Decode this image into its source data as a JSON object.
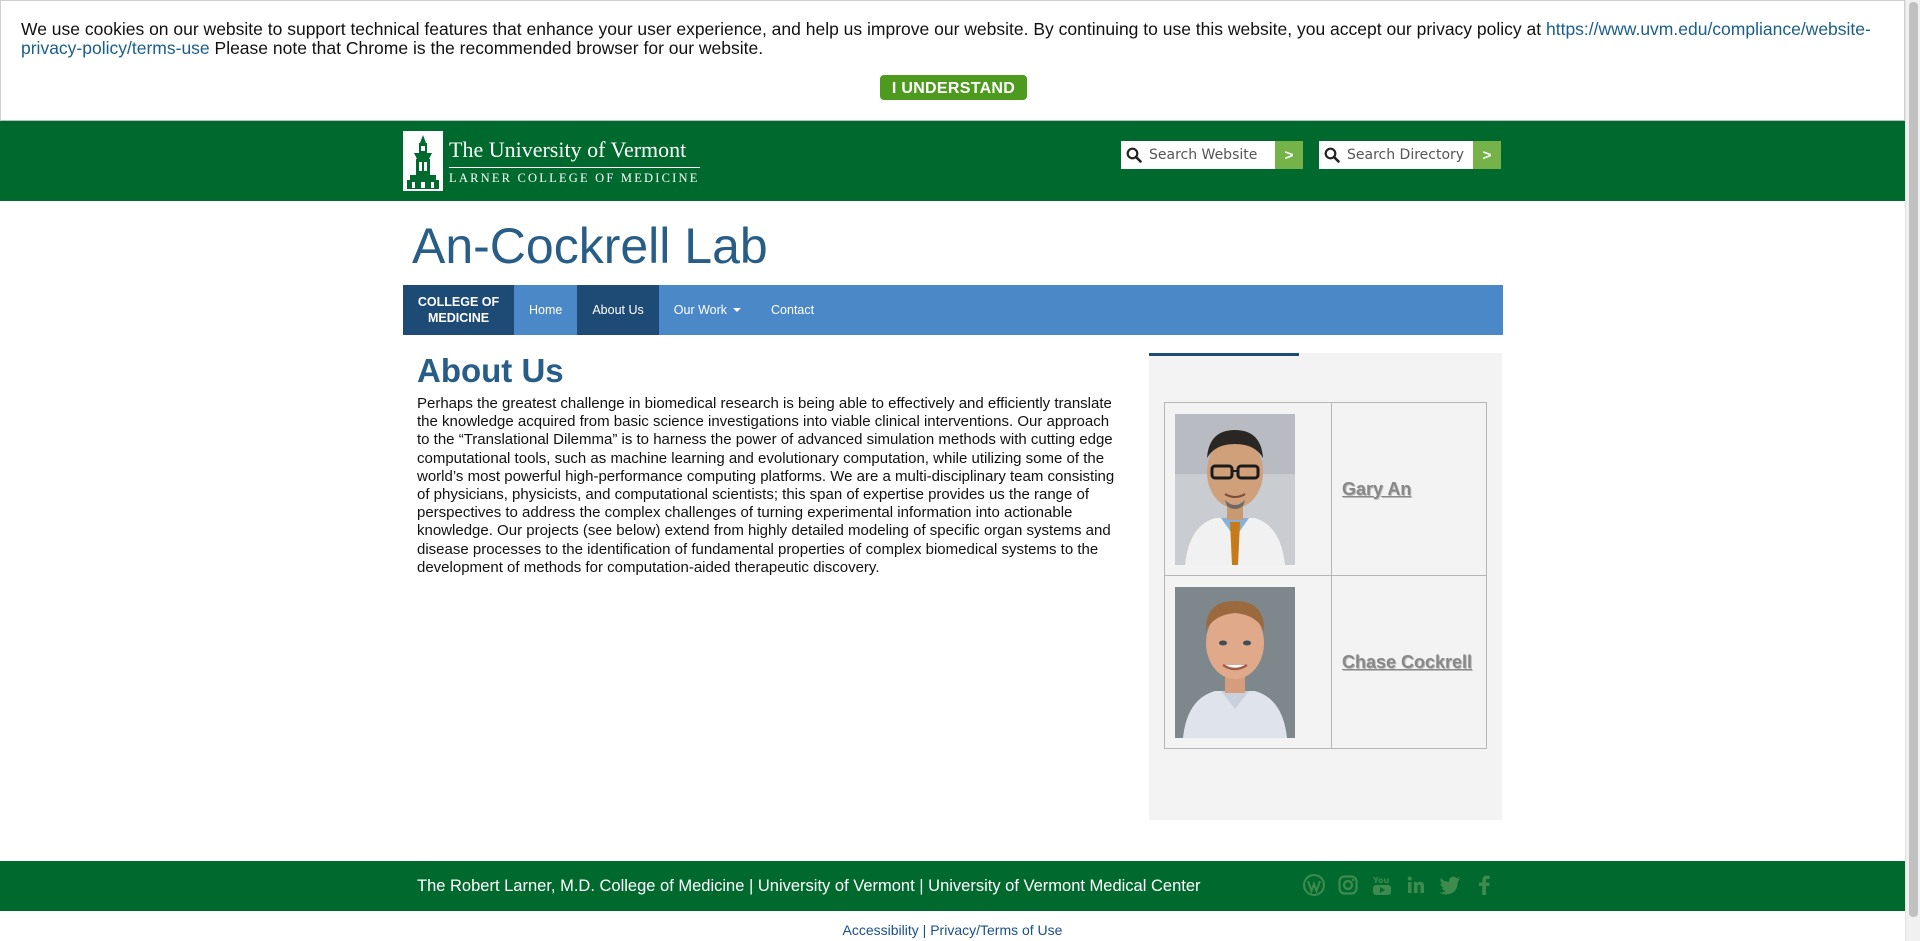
{
  "cookie": {
    "text_before": "We use cookies on our website to support technical features that enhance your user experience, and help us improve our website. By continuing to use this website, you accept our privacy policy at ",
    "link": "https://www.uvm.edu/compliance/website-privacy-policy/terms-use",
    "text_after": " Please note that Chrome is the recommended browser for our website.",
    "button": "I UNDERSTAND"
  },
  "header": {
    "logo_title": "The University of Vermont",
    "logo_subtitle": "LARNER COLLEGE OF MEDICINE",
    "search_website_placeholder": "Search Website",
    "search_directory_placeholder": "Search Directory",
    "go_label": ">"
  },
  "site_title": "An-Cockrell Lab",
  "nav": {
    "college_line1": "COLLEGE OF",
    "college_line2": "MEDICINE",
    "items": [
      {
        "label": "Home"
      },
      {
        "label": "About Us"
      },
      {
        "label": "Our Work"
      },
      {
        "label": "Contact"
      }
    ]
  },
  "main": {
    "heading": "About Us",
    "body": "Perhaps the greatest challenge in biomedical research is being able to effectively and efficiently translate the knowledge acquired from basic science investigations into viable clinical interventions. Our approach to the “Translational Dilemma” is to harness the power of advanced simulation methods with cutting edge computational tools, such as machine learning and evolutionary computation, while utilizing some of the world’s most powerful high-performance computing platforms. We are a multi-disciplinary team consisting of physicians, physicists, and computational scientists; this span of expertise provides us the range of perspectives to address the complex challenges of turning experimental information into actionable knowledge. Our projects (see below) extend from highly detailed modeling of specific organ systems and disease processes to the identification of fundamental properties of complex biomedical systems to the development of methods for computation-aided therapeutic discovery."
  },
  "sidebar": {
    "people": [
      {
        "name": "Gary An"
      },
      {
        "name": "Chase Cockrell"
      }
    ]
  },
  "footer": {
    "link1": "The Robert Larner, M.D. College of Medicine",
    "sep": " | ",
    "link2": "University of Vermont",
    "link3": "University of Vermont Medical Center",
    "social": [
      "wordpress-icon",
      "instagram-icon",
      "youtube-icon",
      "linkedin-icon",
      "twitter-icon",
      "facebook-icon"
    ]
  },
  "bottom": {
    "accessibility": "Accessibility",
    "privacy": "Privacy/Terms of Use",
    "sep": " | "
  },
  "colors": {
    "uvm_green": "#006a2e",
    "nav_blue": "#4a88c8",
    "nav_dark": "#1e4b76",
    "title_blue": "#275d86",
    "button_green": "#4e9a1f",
    "go_green": "#75b24a"
  }
}
